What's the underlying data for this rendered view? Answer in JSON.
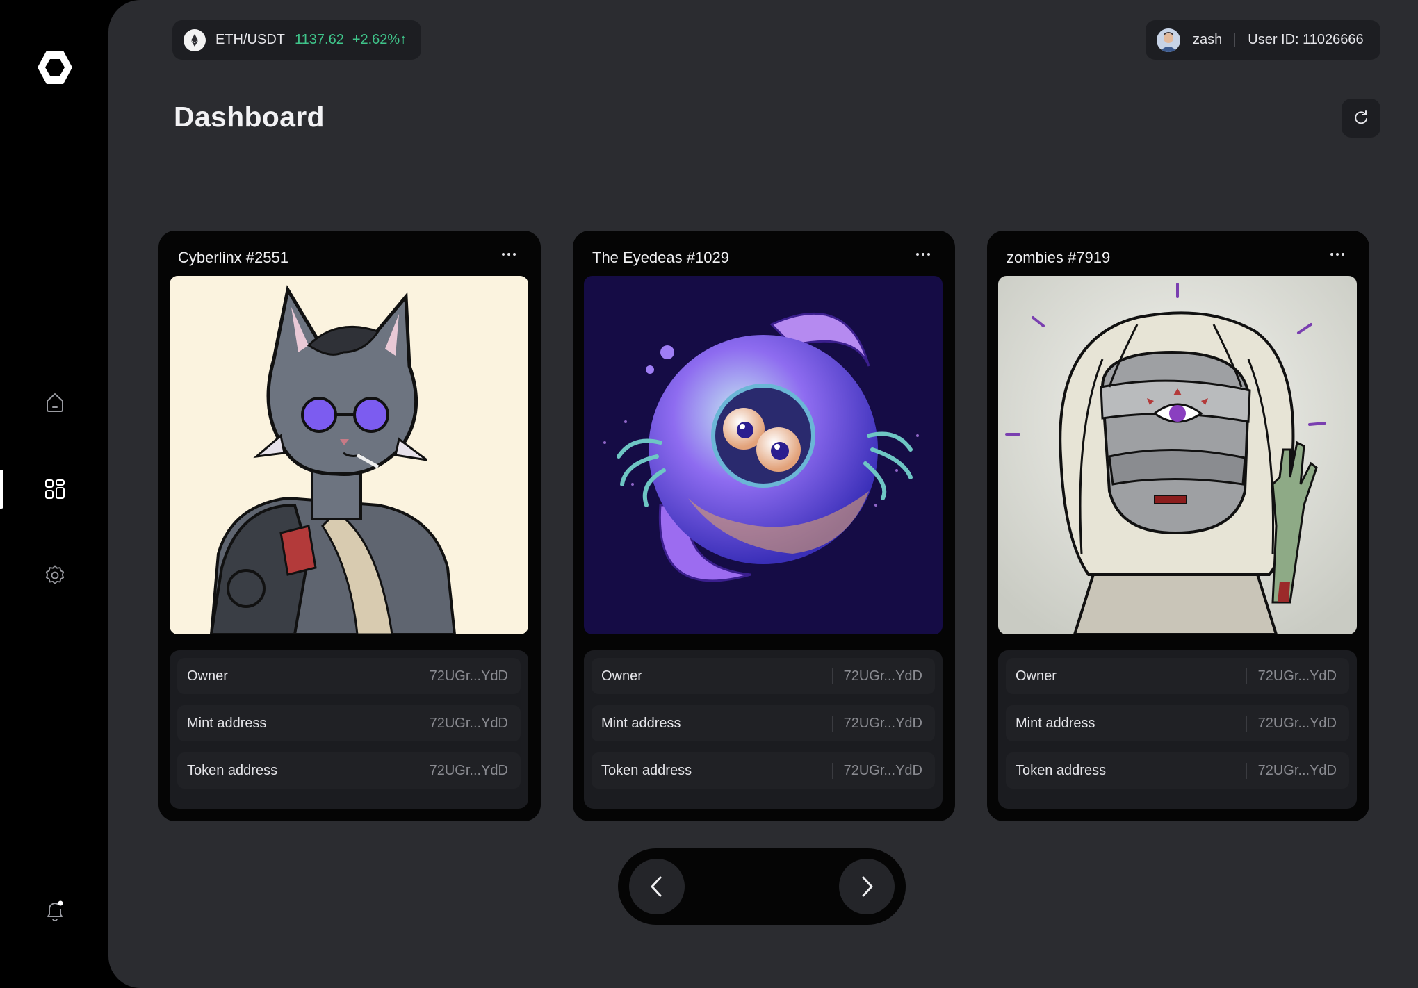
{
  "ticker": {
    "pair": "ETH/USDT",
    "price": "1137.62",
    "change": "+2.62%↑"
  },
  "user": {
    "name": "zash",
    "id_label": "User ID: 11026666"
  },
  "page": {
    "title": "Dashboard"
  },
  "sidebar": {
    "items": [
      {
        "name": "home",
        "icon": "home-icon"
      },
      {
        "name": "dashboard",
        "icon": "grid-icon",
        "active": true
      },
      {
        "name": "settings",
        "icon": "gear-icon"
      },
      {
        "name": "notifications",
        "icon": "bell-icon"
      }
    ]
  },
  "cards": [
    {
      "title": "Cyberlinx #2551",
      "rows": [
        {
          "label": "Owner",
          "value": "72UGr...YdD"
        },
        {
          "label": "Mint address",
          "value": "72UGr...YdD"
        },
        {
          "label": "Token address",
          "value": "72UGr...YdD"
        }
      ]
    },
    {
      "title": "The Eyedeas #1029",
      "rows": [
        {
          "label": "Owner",
          "value": "72UGr...YdD"
        },
        {
          "label": "Mint address",
          "value": "72UGr...YdD"
        },
        {
          "label": "Token address",
          "value": "72UGr...YdD"
        }
      ]
    },
    {
      "title": "zombies #7919",
      "rows": [
        {
          "label": "Owner",
          "value": "72UGr...YdD"
        },
        {
          "label": "Mint address",
          "value": "72UGr...YdD"
        },
        {
          "label": "Token address",
          "value": "72UGr...YdD"
        }
      ]
    }
  ],
  "colors": {
    "background": "#2b2c30",
    "sidebar": "#000000",
    "accent_green": "#3fc48a",
    "card": "#050505"
  }
}
